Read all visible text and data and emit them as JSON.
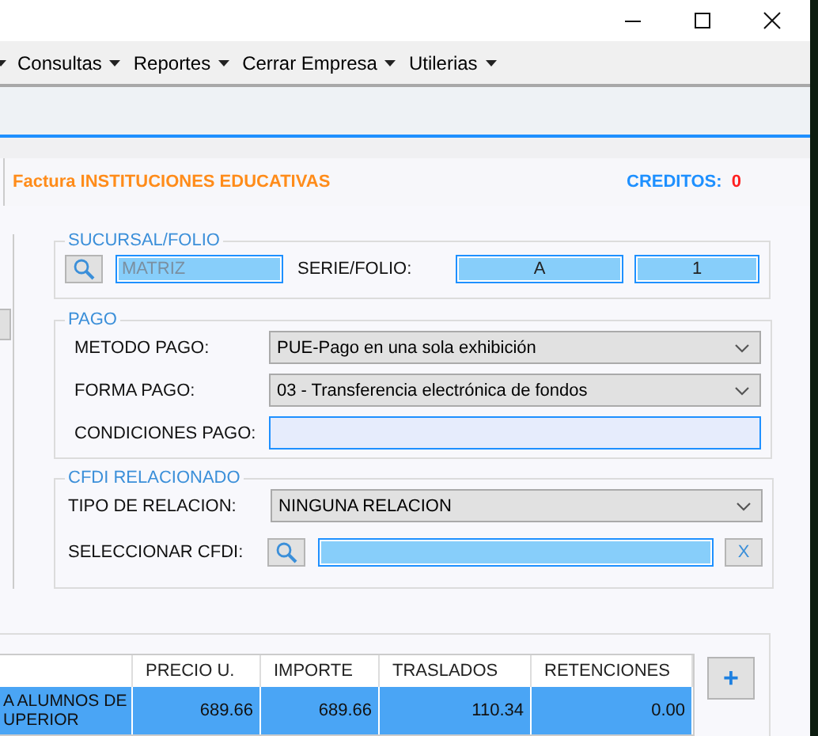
{
  "menu": [
    {
      "label": "Consultas"
    },
    {
      "label": "Reportes"
    },
    {
      "label": "Cerrar Empresa"
    },
    {
      "label": "Utilerias"
    }
  ],
  "header": {
    "title": "Factura INSTITUCIONES EDUCATIVAS",
    "credits_label": "CREDITOS:",
    "credits_value": "0"
  },
  "sucursal": {
    "legend": "SUCURSAL/FOLIO",
    "branch": "MATRIZ",
    "serie_label": "SERIE/FOLIO:",
    "serie": "A",
    "folio": "1"
  },
  "pago": {
    "legend": "PAGO",
    "fields": [
      {
        "kind": "select",
        "label": "METODO PAGO:",
        "value": "PUE-Pago en una sola exhibición"
      },
      {
        "kind": "select",
        "label": "FORMA PAGO:",
        "value": "03 - Transferencia electrónica de fondos"
      },
      {
        "kind": "input",
        "label": "CONDICIONES PAGO:"
      }
    ]
  },
  "cfdi": {
    "legend": "CFDI RELACIONADO",
    "relation_label": "TIPO DE RELACION:",
    "relation": "NINGUNA RELACION",
    "select_label": "SELECCIONAR CFDI:",
    "clear_button": "X"
  },
  "table": {
    "columns": [
      "PRECIO U.",
      "IMPORTE",
      "TRASLADOS",
      "RETENCIONES"
    ],
    "rows": [
      {
        "selected": true,
        "description": [
          "A ALUMNOS DE",
          "UPERIOR"
        ],
        "cells": [
          "689.66",
          "689.66",
          "110.34",
          "0.00"
        ]
      }
    ],
    "add_button": "+"
  }
}
